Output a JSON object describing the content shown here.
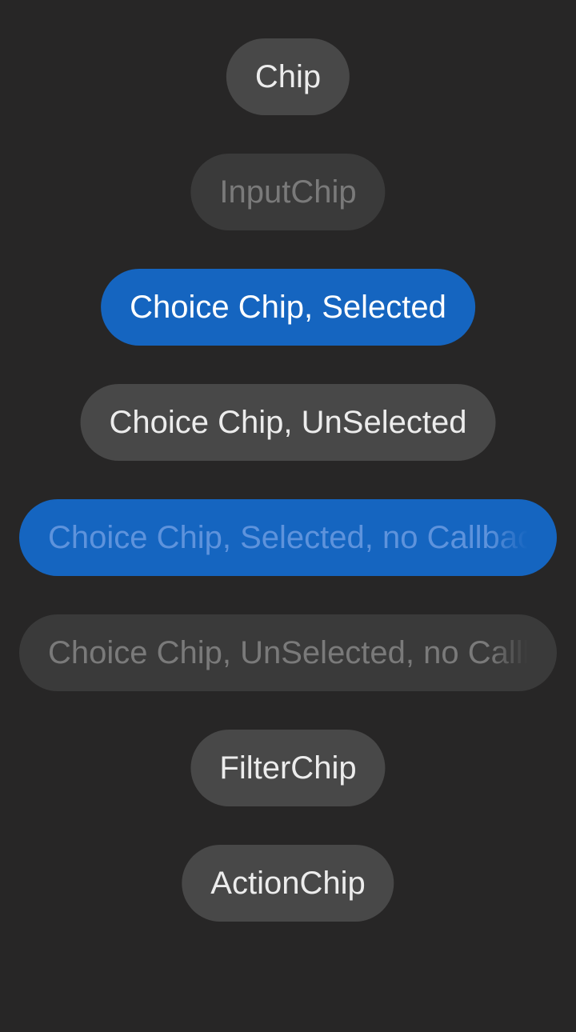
{
  "chips": {
    "chip": "Chip",
    "input_chip": "InputChip",
    "choice_selected": "Choice Chip, Selected",
    "choice_unselected": "Choice Chip, UnSelected",
    "choice_selected_no_callback": "Choice Chip, Selected, no Callback",
    "choice_unselected_no_callback": "Choice Chip, UnSelected, no Callback",
    "filter_chip": "FilterChip",
    "action_chip": "ActionChip"
  },
  "colors": {
    "background": "#272626",
    "chip_background": "#484848",
    "chip_disabled_background": "#3a3a3a",
    "selected_background": "#1565c0",
    "text": "#ececec",
    "disabled_text": "#7a7a7a",
    "selected_disabled_text": "#5e93dc"
  }
}
